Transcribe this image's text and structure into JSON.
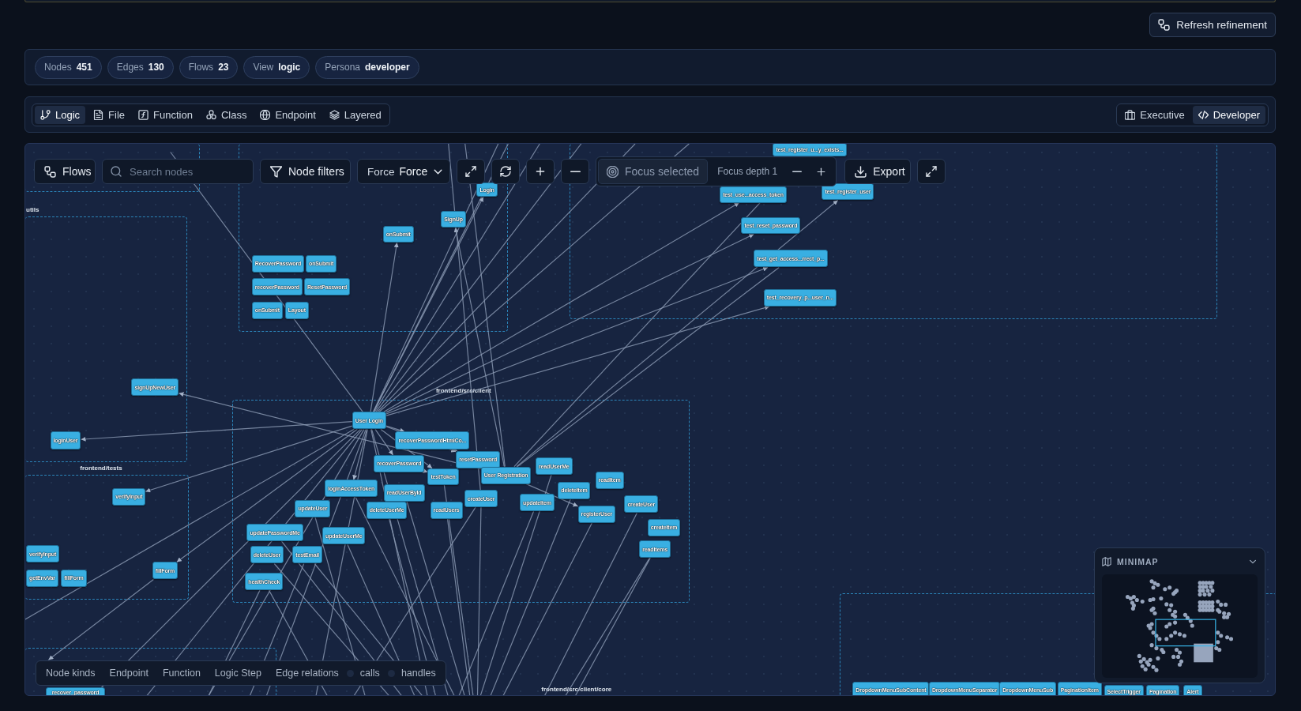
{
  "refresh_button": "Refresh refinement",
  "stats": [
    {
      "label": "Nodes",
      "value": "451"
    },
    {
      "label": "Edges",
      "value": "130"
    },
    {
      "label": "Flows",
      "value": "23"
    },
    {
      "label": "View",
      "value": "logic"
    },
    {
      "label": "Persona",
      "value": "developer"
    }
  ],
  "view_tabs": [
    {
      "kind": "logic",
      "label": "Logic",
      "selected": true
    },
    {
      "kind": "file",
      "label": "File",
      "selected": false
    },
    {
      "kind": "function",
      "label": "Function",
      "selected": false
    },
    {
      "kind": "class",
      "label": "Class",
      "selected": false
    },
    {
      "kind": "endpoint",
      "label": "Endpoint",
      "selected": false
    },
    {
      "kind": "layered",
      "label": "Layered",
      "selected": false
    }
  ],
  "persona_tabs": [
    {
      "kind": "executive",
      "label": "Executive",
      "selected": false
    },
    {
      "kind": "developer",
      "label": "Developer",
      "selected": true
    }
  ],
  "graph": {
    "toolbar": {
      "flows_button": "Flows",
      "search": {
        "placeholder": "Search nodes"
      },
      "filters_button": "Node filters",
      "layout": {
        "label": "Force",
        "value": "Force"
      },
      "focus": {
        "button": "Focus selected",
        "disabled": true,
        "depth_label": "Focus depth 1"
      },
      "export_button": "Export"
    },
    "groups": [
      {
        "label": "utils"
      },
      {
        "label": "frontend/tests"
      },
      {
        "label": "frontend/src/client"
      },
      {
        "label": "frontend/src/client/core"
      }
    ],
    "nodes": [
      {
        "label": "test_register_u...y_exists..."
      },
      {
        "label": "Login"
      },
      {
        "label": "SignUp"
      },
      {
        "label": "onSubmit"
      },
      {
        "label": "RecoverPassword"
      },
      {
        "label": "onSubmit"
      },
      {
        "label": "recoverPassword"
      },
      {
        "label": "ResetPassword"
      },
      {
        "label": "onSubmit"
      },
      {
        "label": "Layout"
      },
      {
        "label": "test_use...access_token"
      },
      {
        "label": "test_register_user"
      },
      {
        "label": "test_reset_password"
      },
      {
        "label": "test_get_access...rrect_p..."
      },
      {
        "label": "test_recovery_p...user_n..."
      },
      {
        "label": "signUpNewUser"
      },
      {
        "label": "loginUser"
      },
      {
        "label": "verifyInput"
      },
      {
        "label": "verifyInput"
      },
      {
        "label": "getEnvVar"
      },
      {
        "label": "fillForm"
      },
      {
        "label": "fillForm"
      },
      {
        "label": "User Login"
      },
      {
        "label": "recoverPasswordHtmlCo..."
      },
      {
        "label": "recoverPassword"
      },
      {
        "label": "resetPassword"
      },
      {
        "label": "testToken"
      },
      {
        "label": "User Registration"
      },
      {
        "label": "readUserMe"
      },
      {
        "label": "loginAccessToken"
      },
      {
        "label": "readUserById"
      },
      {
        "label": "createUser"
      },
      {
        "label": "deleteItem"
      },
      {
        "label": "readItem"
      },
      {
        "label": "updateItem"
      },
      {
        "label": "updateUser"
      },
      {
        "label": "deleteUserMe"
      },
      {
        "label": "readUsers"
      },
      {
        "label": "registerUser"
      },
      {
        "label": "createUser"
      },
      {
        "label": "createItem"
      },
      {
        "label": "readItems"
      },
      {
        "label": "updatePasswordMe"
      },
      {
        "label": "updateUserMe"
      },
      {
        "label": "deleteUser"
      },
      {
        "label": "testEmail"
      },
      {
        "label": "healthCheck"
      },
      {
        "label": "recover_password"
      },
      {
        "label": "DropdownMenuSubContent"
      },
      {
        "label": "DropdownMenuSeparator"
      },
      {
        "label": "DropdownMenuSub"
      },
      {
        "label": "PaginationItem"
      },
      {
        "label": "SelectTrigger"
      },
      {
        "label": "Pagination"
      },
      {
        "label": "Alert"
      }
    ],
    "legend": {
      "kinds_title": "Node kinds",
      "kinds": [
        "Endpoint",
        "Function",
        "Logic Step"
      ],
      "relations_title": "Edge relations",
      "relations": [
        "calls",
        "handles"
      ]
    },
    "minimap": {
      "title": "MINIMAP"
    }
  }
}
